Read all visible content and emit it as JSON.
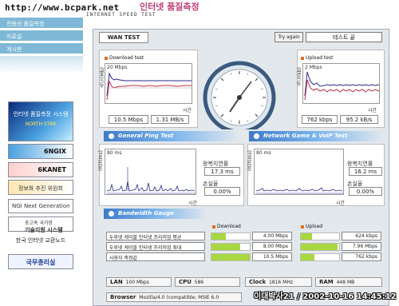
{
  "header": {
    "site_url": "http://www.bcpark.net",
    "logo_text": "인터넷 품질측정",
    "logo_sub": "INTERNET SPEED TEST"
  },
  "sidebar": {
    "items": [
      {
        "label": "전용선 품질측정"
      },
      {
        "label": "자료실"
      },
      {
        "label": "게시판"
      }
    ],
    "banners": [
      {
        "line1": "인터넷 품질측정 시스템",
        "line2": "NORTH STAR"
      },
      {
        "label": "6NGIX"
      },
      {
        "label": "6KANET"
      },
      {
        "label": "정보화 추진 위원회"
      },
      {
        "label": "NGI Next Generation"
      },
      {
        "line1": "초고속 국가망",
        "line2": "기술지원 시스템"
      },
      {
        "label": "한국 인터넷 교환노드"
      },
      {
        "label": "국무총리실"
      }
    ]
  },
  "toolbar": {
    "tab_label": "WAN TEST",
    "try_again_label": "Try again",
    "status_label": "테스트 끝"
  },
  "download": {
    "title": "Download test",
    "max_label": "20 Mbps",
    "axis_time": "시간",
    "axis_speed": "속도(Mb)",
    "speed_mbps": "10.5 Mbps",
    "speed_mbs": "1.31 MB/s"
  },
  "upload": {
    "title": "Upload test",
    "max_label": "2 Mbps",
    "axis_time": "시간",
    "axis_speed": "속도(kb)",
    "speed_kbps": "762 kbps",
    "speed_kbs": "95.2 kB/s"
  },
  "sections": {
    "ping": "General Ping Test",
    "game": "Network Game & VoIP Test",
    "gauge": "Bandwidth Gauge"
  },
  "ping": {
    "max_label": "80 ms",
    "axis_time": "시간",
    "axis_y": "응답(ms)",
    "rtt_label": "왕복지연률",
    "rtt_value": "17.3 ms",
    "loss_label": "손실율",
    "loss_value": "0.00%"
  },
  "game": {
    "max_label": "80 ms",
    "axis_time": "시간",
    "axis_y": "응답(ms)",
    "rtt_label": "왕복지연률",
    "rtt_value": "16.2 ms",
    "loss_label": "손실율",
    "loss_value": "0.00%"
  },
  "gauge": {
    "download_title": "Download",
    "upload_title": "Upload",
    "rows": [
      {
        "label": "두루넷 케이블 인터넷 프리미엄 평균",
        "down": "4.00 Mbps",
        "up": "624 kbps",
        "down_pct": 0.38,
        "up_pct": 0.3
      },
      {
        "label": "두루넷 케이블 인터넷 프리미엄 최대",
        "down": "8.00 Mbps",
        "up": "7.96 Mbps",
        "down_pct": 0.76,
        "up_pct": 0.95
      },
      {
        "label": "사용자 측정값",
        "down": "10.5 Mbps",
        "up": "762 kbps",
        "down_pct": 1.0,
        "up_pct": 0.36
      }
    ]
  },
  "system": {
    "lan_label": "LAN",
    "lan_value": "100 Mbps",
    "cpu_label": "CPU",
    "cpu_value": "586",
    "clock_label": "Clock",
    "clock_value": "1816 MHz",
    "ram_label": "RAM",
    "ram_value": "448 MB",
    "browser_label": "Browser",
    "browser_value": "Mozilla/4.0 (compatible; MSIE 6.0"
  },
  "watermark": "이대박사21 / 2002-10-16 14:45:12",
  "colors": {
    "accent_orange": "#e07020",
    "section_blue": "#3f7bc8",
    "gauge_green": "#a8d840",
    "nav_blue": "#7fb8d6",
    "download_line": "#c03040",
    "ref_line": "#2a2a90"
  }
}
